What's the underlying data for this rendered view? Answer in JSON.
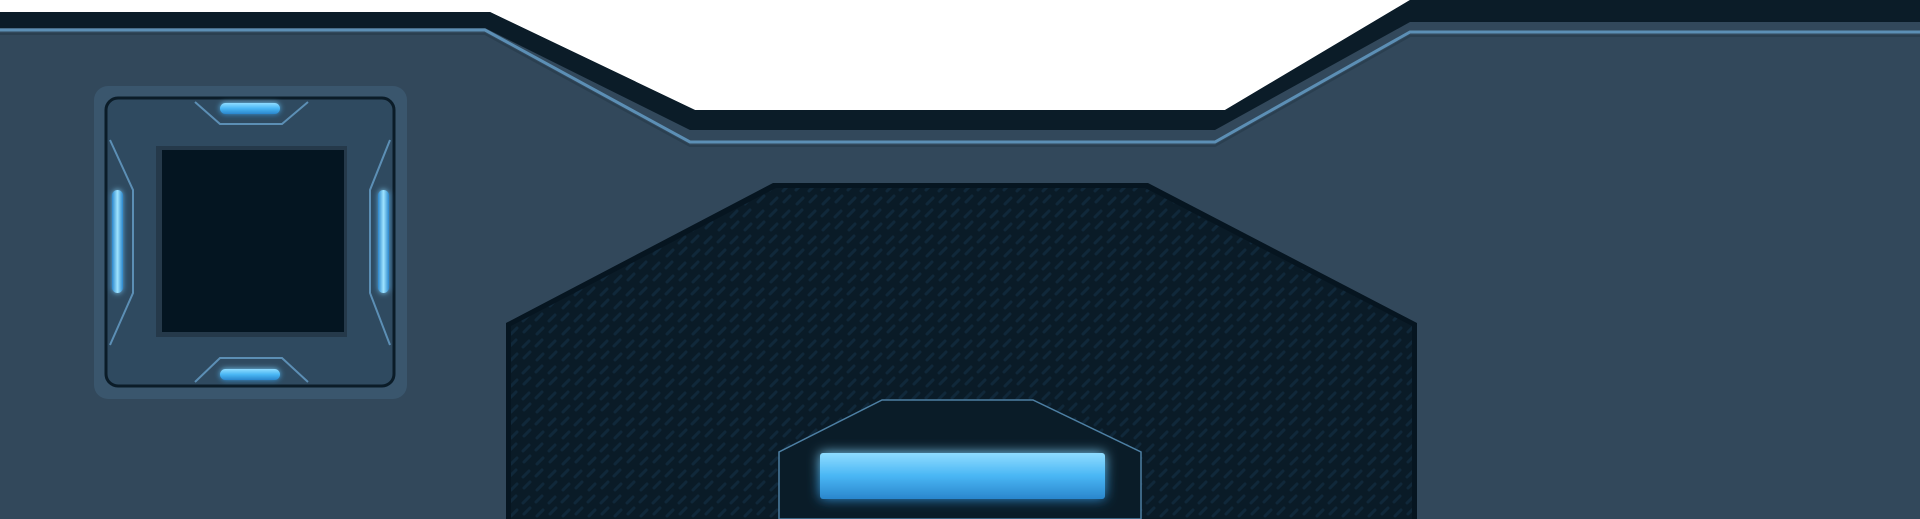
{
  "theme": {
    "background": "#ffffff",
    "panel": "#32485b",
    "panel_dark": "#0b1c28",
    "panel_inner": "#071722",
    "edge_highlight": "#5c8fb5",
    "module_fill": "#3a566d",
    "glow": "#49b6f4",
    "glow_core": "#9fe4ff"
  },
  "icons": {
    "side_module": "square-socket-icon",
    "indicator": "light-bar-icon"
  }
}
